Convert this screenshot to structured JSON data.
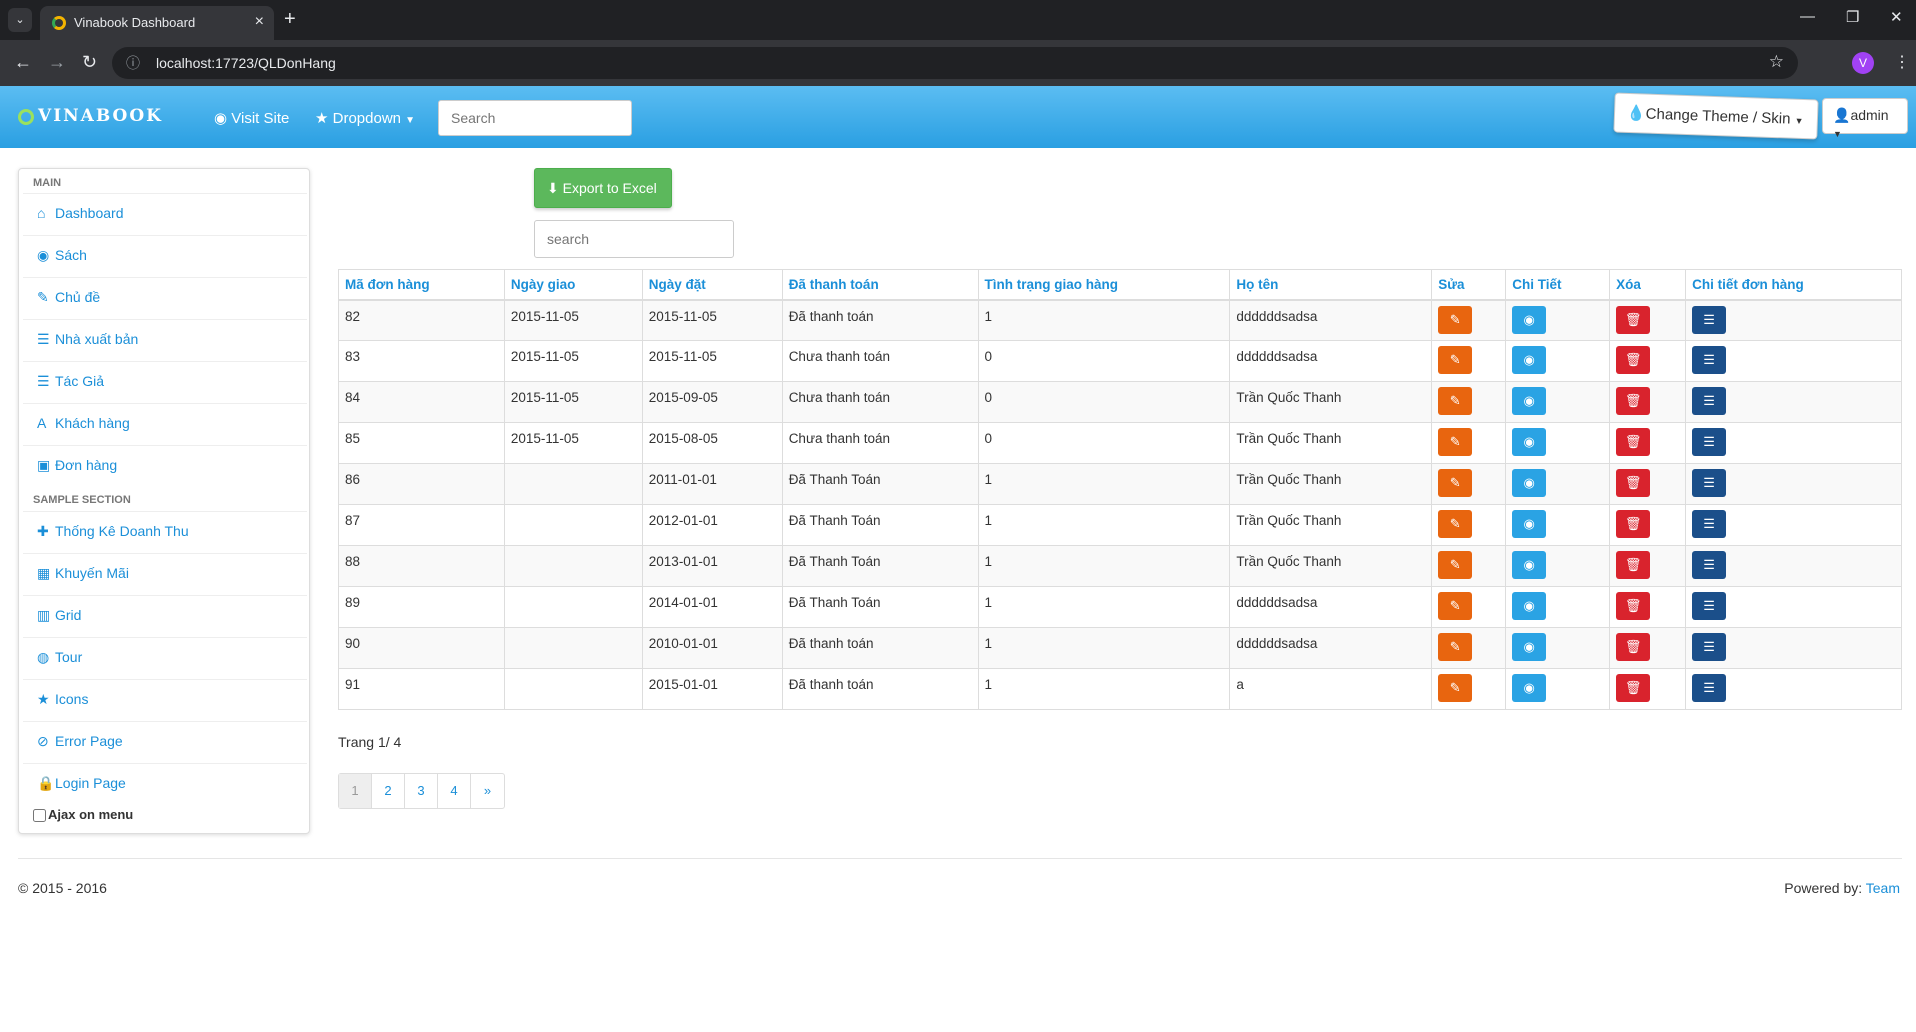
{
  "browser": {
    "tab_title": "Vinabook Dashboard",
    "url": "localhost:17723/QLDonHang"
  },
  "navbar": {
    "brand": "VINABOOK",
    "visit_site": "Visit Site",
    "dropdown": "Dropdown",
    "search_placeholder": "Search",
    "theme": "Change Theme / Skin",
    "user": "admin"
  },
  "sidebar": {
    "main_header": "MAIN",
    "sample_header": "SAMPLE SECTION",
    "items": [
      {
        "label": "Dashboard",
        "icon": "home-icon"
      },
      {
        "label": "Sách",
        "icon": "eye-icon"
      },
      {
        "label": "Chủ đề",
        "icon": "edit-icon"
      },
      {
        "label": "Nhà xuất bản",
        "icon": "list-icon"
      },
      {
        "label": "Tác Giả",
        "icon": "list-icon"
      },
      {
        "label": "Khách hàng",
        "icon": "font-icon"
      },
      {
        "label": "Đơn hàng",
        "icon": "picture-icon"
      },
      {
        "label": "Thống Kê Doanh Thu",
        "icon": "plus-icon"
      },
      {
        "label": "Khuyến Mãi",
        "icon": "calendar-icon"
      },
      {
        "label": "Grid",
        "icon": "grid-icon"
      },
      {
        "label": "Tour",
        "icon": "globe-icon"
      },
      {
        "label": "Icons",
        "icon": "star-icon"
      },
      {
        "label": "Error Page",
        "icon": "ban-icon"
      },
      {
        "label": "Login Page",
        "icon": "lock-icon"
      }
    ],
    "ajax_label": "Ajax on menu"
  },
  "main": {
    "export_label": "Export to Excel",
    "search_placeholder": "search",
    "columns": [
      "Mã đơn hàng",
      "Ngày giao",
      "Ngày đặt",
      "Đã thanh toán",
      "Tình trạng giao hàng",
      "Họ tên",
      "Sửa",
      "Chi Tiết",
      "Xóa",
      "Chi tiết đơn hàng"
    ],
    "rows": [
      {
        "id": "82",
        "ngay_giao": "2015-11-05",
        "ngay_dat": "2015-11-05",
        "thanh_toan": "Đã thanh toán",
        "tinh_trang": "1",
        "ho_ten": "ddddddsadsa"
      },
      {
        "id": "83",
        "ngay_giao": "2015-11-05",
        "ngay_dat": "2015-11-05",
        "thanh_toan": "Chưa thanh toán",
        "tinh_trang": "0",
        "ho_ten": "ddddddsadsa"
      },
      {
        "id": "84",
        "ngay_giao": "2015-11-05",
        "ngay_dat": "2015-09-05",
        "thanh_toan": "Chưa thanh toán",
        "tinh_trang": "0",
        "ho_ten": "Trần Quốc Thanh"
      },
      {
        "id": "85",
        "ngay_giao": "2015-11-05",
        "ngay_dat": "2015-08-05",
        "thanh_toan": "Chưa thanh toán",
        "tinh_trang": "0",
        "ho_ten": "Trần Quốc Thanh"
      },
      {
        "id": "86",
        "ngay_giao": "",
        "ngay_dat": "2011-01-01",
        "thanh_toan": "Đã Thanh Toán",
        "tinh_trang": "1",
        "ho_ten": "Trần Quốc Thanh"
      },
      {
        "id": "87",
        "ngay_giao": "",
        "ngay_dat": "2012-01-01",
        "thanh_toan": "Đã Thanh Toán",
        "tinh_trang": "1",
        "ho_ten": "Trần Quốc Thanh"
      },
      {
        "id": "88",
        "ngay_giao": "",
        "ngay_dat": "2013-01-01",
        "thanh_toan": "Đã Thanh Toán",
        "tinh_trang": "1",
        "ho_ten": "Trần Quốc Thanh"
      },
      {
        "id": "89",
        "ngay_giao": "",
        "ngay_dat": "2014-01-01",
        "thanh_toan": "Đã Thanh Toán",
        "tinh_trang": "1",
        "ho_ten": "ddddddsadsa"
      },
      {
        "id": "90",
        "ngay_giao": "",
        "ngay_dat": "2010-01-01",
        "thanh_toan": "Đã thanh toán",
        "tinh_trang": "1",
        "ho_ten": "ddddddsadsa"
      },
      {
        "id": "91",
        "ngay_giao": "",
        "ngay_dat": "2015-01-01",
        "thanh_toan": "Đã thanh toán",
        "tinh_trang": "1",
        "ho_ten": "a"
      }
    ],
    "page_info": "Trang 1/ 4",
    "pages": [
      "1",
      "2",
      "3",
      "4",
      "»"
    ]
  },
  "footer": {
    "copyright": "© 2015 - 2016",
    "powered_by": "Powered by:",
    "team": "Team"
  }
}
